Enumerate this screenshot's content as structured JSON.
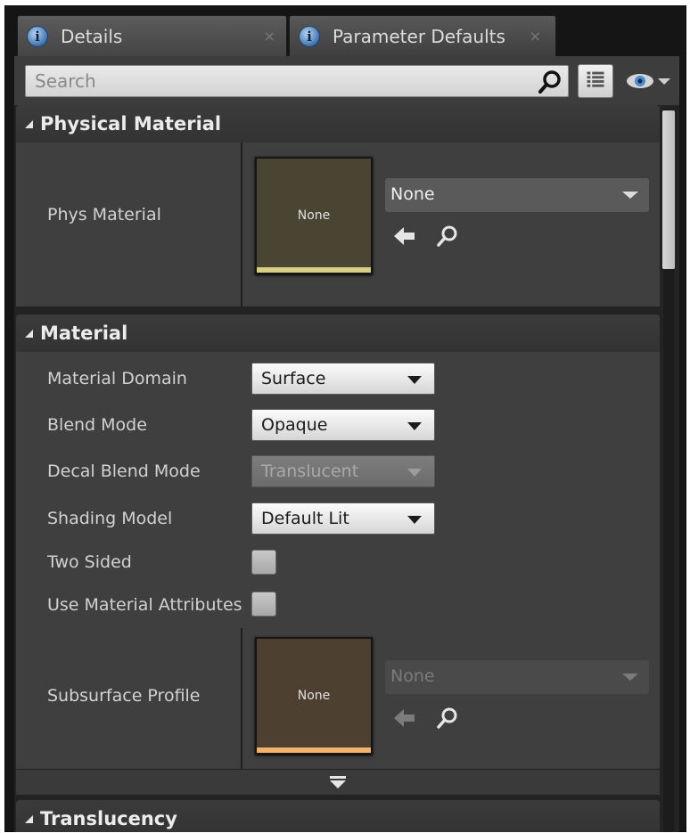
{
  "tabs": [
    {
      "label": "Details",
      "close": "×"
    },
    {
      "label": "Parameter Defaults",
      "close": "×"
    }
  ],
  "search": {
    "placeholder": "Search",
    "value": ""
  },
  "sections": {
    "physical": {
      "title": "Physical Material",
      "phys_label": "Phys Material",
      "thumb_text": "None",
      "asset_value": "None"
    },
    "material": {
      "title": "Material",
      "rows": [
        {
          "label": "Material Domain",
          "value": "Surface"
        },
        {
          "label": "Blend Mode",
          "value": "Opaque"
        },
        {
          "label": "Decal Blend Mode",
          "value": "Translucent"
        },
        {
          "label": "Shading Model",
          "value": "Default Lit"
        },
        {
          "label": "Two Sided"
        },
        {
          "label": "Use Material Attributes"
        }
      ],
      "subsurface": {
        "label": "Subsurface Profile",
        "thumb_text": "None",
        "asset_value": "None"
      }
    },
    "translucency": {
      "title": "Translucency"
    }
  },
  "icons": {
    "tab": "info-icon",
    "search": "search-icon",
    "view": "view-options-icon",
    "visibility": "eye-icon",
    "browse": "arrow-left-icon",
    "find": "magnifier-icon",
    "advanced": "expand-advanced-icon"
  },
  "colors": {
    "background": "#232323",
    "section_header": "#383838",
    "row": "#3f3f3f",
    "phys_thumb_stripe": "#d8cf86",
    "subsurface_thumb_stripe": "#f1b36b"
  }
}
